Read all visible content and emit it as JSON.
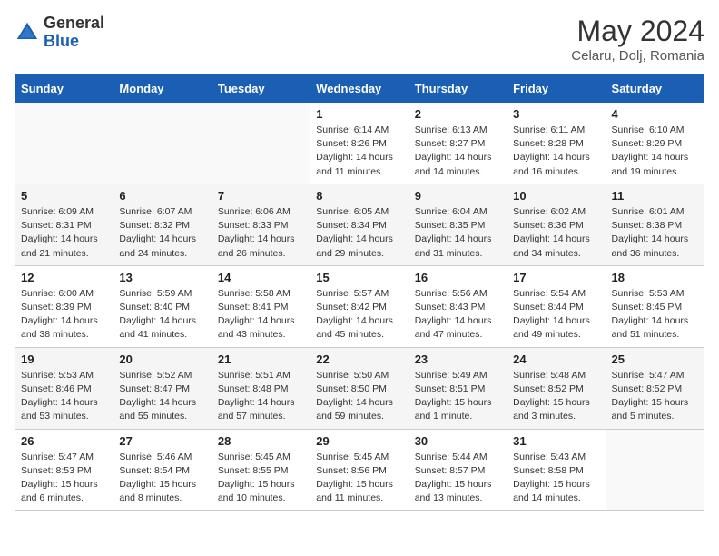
{
  "header": {
    "logo_general": "General",
    "logo_blue": "Blue",
    "month": "May 2024",
    "location": "Celaru, Dolj, Romania"
  },
  "weekdays": [
    "Sunday",
    "Monday",
    "Tuesday",
    "Wednesday",
    "Thursday",
    "Friday",
    "Saturday"
  ],
  "weeks": [
    [
      {
        "day": "",
        "sunrise": "",
        "sunset": "",
        "daylight": ""
      },
      {
        "day": "",
        "sunrise": "",
        "sunset": "",
        "daylight": ""
      },
      {
        "day": "",
        "sunrise": "",
        "sunset": "",
        "daylight": ""
      },
      {
        "day": "1",
        "sunrise": "Sunrise: 6:14 AM",
        "sunset": "Sunset: 8:26 PM",
        "daylight": "Daylight: 14 hours and 11 minutes."
      },
      {
        "day": "2",
        "sunrise": "Sunrise: 6:13 AM",
        "sunset": "Sunset: 8:27 PM",
        "daylight": "Daylight: 14 hours and 14 minutes."
      },
      {
        "day": "3",
        "sunrise": "Sunrise: 6:11 AM",
        "sunset": "Sunset: 8:28 PM",
        "daylight": "Daylight: 14 hours and 16 minutes."
      },
      {
        "day": "4",
        "sunrise": "Sunrise: 6:10 AM",
        "sunset": "Sunset: 8:29 PM",
        "daylight": "Daylight: 14 hours and 19 minutes."
      }
    ],
    [
      {
        "day": "5",
        "sunrise": "Sunrise: 6:09 AM",
        "sunset": "Sunset: 8:31 PM",
        "daylight": "Daylight: 14 hours and 21 minutes."
      },
      {
        "day": "6",
        "sunrise": "Sunrise: 6:07 AM",
        "sunset": "Sunset: 8:32 PM",
        "daylight": "Daylight: 14 hours and 24 minutes."
      },
      {
        "day": "7",
        "sunrise": "Sunrise: 6:06 AM",
        "sunset": "Sunset: 8:33 PM",
        "daylight": "Daylight: 14 hours and 26 minutes."
      },
      {
        "day": "8",
        "sunrise": "Sunrise: 6:05 AM",
        "sunset": "Sunset: 8:34 PM",
        "daylight": "Daylight: 14 hours and 29 minutes."
      },
      {
        "day": "9",
        "sunrise": "Sunrise: 6:04 AM",
        "sunset": "Sunset: 8:35 PM",
        "daylight": "Daylight: 14 hours and 31 minutes."
      },
      {
        "day": "10",
        "sunrise": "Sunrise: 6:02 AM",
        "sunset": "Sunset: 8:36 PM",
        "daylight": "Daylight: 14 hours and 34 minutes."
      },
      {
        "day": "11",
        "sunrise": "Sunrise: 6:01 AM",
        "sunset": "Sunset: 8:38 PM",
        "daylight": "Daylight: 14 hours and 36 minutes."
      }
    ],
    [
      {
        "day": "12",
        "sunrise": "Sunrise: 6:00 AM",
        "sunset": "Sunset: 8:39 PM",
        "daylight": "Daylight: 14 hours and 38 minutes."
      },
      {
        "day": "13",
        "sunrise": "Sunrise: 5:59 AM",
        "sunset": "Sunset: 8:40 PM",
        "daylight": "Daylight: 14 hours and 41 minutes."
      },
      {
        "day": "14",
        "sunrise": "Sunrise: 5:58 AM",
        "sunset": "Sunset: 8:41 PM",
        "daylight": "Daylight: 14 hours and 43 minutes."
      },
      {
        "day": "15",
        "sunrise": "Sunrise: 5:57 AM",
        "sunset": "Sunset: 8:42 PM",
        "daylight": "Daylight: 14 hours and 45 minutes."
      },
      {
        "day": "16",
        "sunrise": "Sunrise: 5:56 AM",
        "sunset": "Sunset: 8:43 PM",
        "daylight": "Daylight: 14 hours and 47 minutes."
      },
      {
        "day": "17",
        "sunrise": "Sunrise: 5:54 AM",
        "sunset": "Sunset: 8:44 PM",
        "daylight": "Daylight: 14 hours and 49 minutes."
      },
      {
        "day": "18",
        "sunrise": "Sunrise: 5:53 AM",
        "sunset": "Sunset: 8:45 PM",
        "daylight": "Daylight: 14 hours and 51 minutes."
      }
    ],
    [
      {
        "day": "19",
        "sunrise": "Sunrise: 5:53 AM",
        "sunset": "Sunset: 8:46 PM",
        "daylight": "Daylight: 14 hours and 53 minutes."
      },
      {
        "day": "20",
        "sunrise": "Sunrise: 5:52 AM",
        "sunset": "Sunset: 8:47 PM",
        "daylight": "Daylight: 14 hours and 55 minutes."
      },
      {
        "day": "21",
        "sunrise": "Sunrise: 5:51 AM",
        "sunset": "Sunset: 8:48 PM",
        "daylight": "Daylight: 14 hours and 57 minutes."
      },
      {
        "day": "22",
        "sunrise": "Sunrise: 5:50 AM",
        "sunset": "Sunset: 8:50 PM",
        "daylight": "Daylight: 14 hours and 59 minutes."
      },
      {
        "day": "23",
        "sunrise": "Sunrise: 5:49 AM",
        "sunset": "Sunset: 8:51 PM",
        "daylight": "Daylight: 15 hours and 1 minute."
      },
      {
        "day": "24",
        "sunrise": "Sunrise: 5:48 AM",
        "sunset": "Sunset: 8:52 PM",
        "daylight": "Daylight: 15 hours and 3 minutes."
      },
      {
        "day": "25",
        "sunrise": "Sunrise: 5:47 AM",
        "sunset": "Sunset: 8:52 PM",
        "daylight": "Daylight: 15 hours and 5 minutes."
      }
    ],
    [
      {
        "day": "26",
        "sunrise": "Sunrise: 5:47 AM",
        "sunset": "Sunset: 8:53 PM",
        "daylight": "Daylight: 15 hours and 6 minutes."
      },
      {
        "day": "27",
        "sunrise": "Sunrise: 5:46 AM",
        "sunset": "Sunset: 8:54 PM",
        "daylight": "Daylight: 15 hours and 8 minutes."
      },
      {
        "day": "28",
        "sunrise": "Sunrise: 5:45 AM",
        "sunset": "Sunset: 8:55 PM",
        "daylight": "Daylight: 15 hours and 10 minutes."
      },
      {
        "day": "29",
        "sunrise": "Sunrise: 5:45 AM",
        "sunset": "Sunset: 8:56 PM",
        "daylight": "Daylight: 15 hours and 11 minutes."
      },
      {
        "day": "30",
        "sunrise": "Sunrise: 5:44 AM",
        "sunset": "Sunset: 8:57 PM",
        "daylight": "Daylight: 15 hours and 13 minutes."
      },
      {
        "day": "31",
        "sunrise": "Sunrise: 5:43 AM",
        "sunset": "Sunset: 8:58 PM",
        "daylight": "Daylight: 15 hours and 14 minutes."
      },
      {
        "day": "",
        "sunrise": "",
        "sunset": "",
        "daylight": ""
      }
    ]
  ]
}
